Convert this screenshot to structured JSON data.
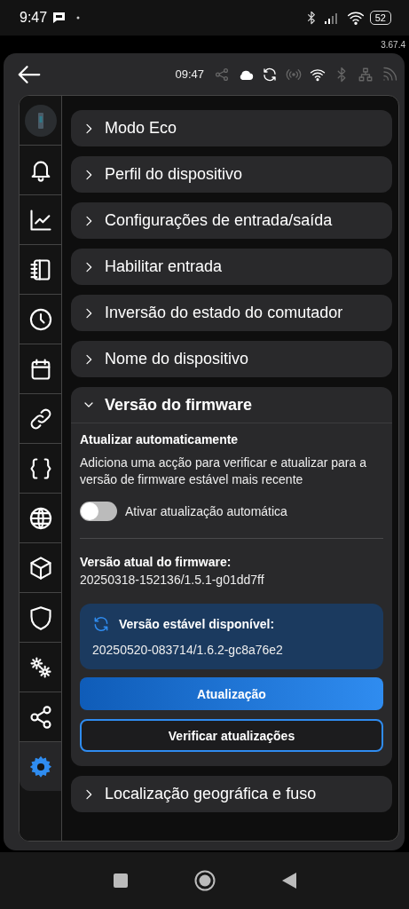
{
  "status_bar": {
    "time": "9:47",
    "battery": "52"
  },
  "app_version": "3.67.4",
  "header": {
    "time": "09:47",
    "indicators": [
      {
        "active": false
      },
      {
        "active": true
      },
      {
        "active": true
      },
      {
        "active": false
      },
      {
        "active": true
      },
      {
        "active": false
      },
      {
        "active": false
      },
      {
        "active": false
      }
    ]
  },
  "sidebar": {
    "items": [
      {
        "selected": false
      },
      {
        "selected": false
      },
      {
        "selected": false
      },
      {
        "selected": false
      },
      {
        "selected": false
      },
      {
        "selected": false
      },
      {
        "selected": false
      },
      {
        "selected": false
      },
      {
        "selected": false
      },
      {
        "selected": false
      },
      {
        "selected": false
      },
      {
        "selected": false
      },
      {
        "selected": false
      },
      {
        "selected": true
      }
    ]
  },
  "sections": [
    {
      "title": "Modo Eco",
      "expanded": false
    },
    {
      "title": "Perfil do dispositivo",
      "expanded": false
    },
    {
      "title": "Configurações de entrada/saída",
      "expanded": false
    },
    {
      "title": "Habilitar entrada",
      "expanded": false
    },
    {
      "title": "Inversão do estado do comutador",
      "expanded": false
    },
    {
      "title": "Nome do dispositivo",
      "expanded": false
    },
    {
      "title": "Versão do firmware",
      "expanded": true,
      "auto_update": {
        "heading": "Atualizar automaticamente",
        "description": "Adiciona uma acção para verificar e atualizar para a versão de firmware estável mais recente",
        "toggle": {
          "label": "Ativar atualização automática",
          "on": false
        }
      },
      "current": {
        "label": "Versão atual do firmware:",
        "value": "20250318-152136/1.5.1-g01dd7ff"
      },
      "available": {
        "label": "Versão estável disponível:",
        "value": "20250520-083714/1.6.2-gc8a76e2"
      },
      "buttons": [
        "Atualização",
        "Verificar atualizações"
      ]
    },
    {
      "title": "Localização geográfica e fuso",
      "expanded": false
    }
  ]
}
